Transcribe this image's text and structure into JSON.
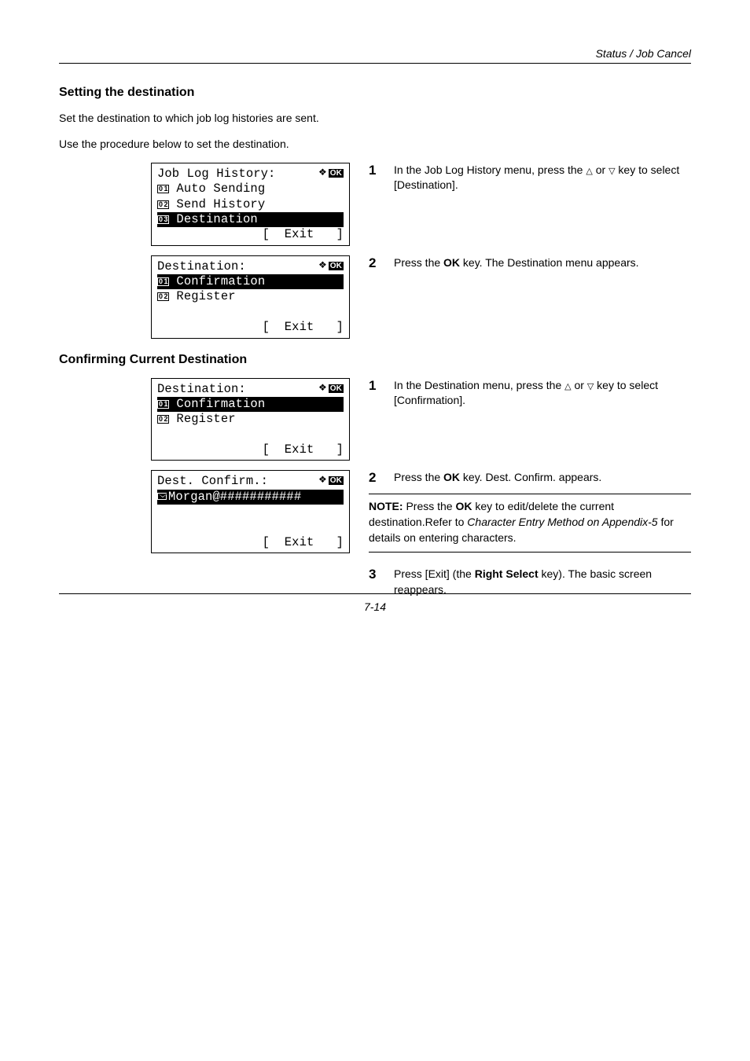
{
  "header": {
    "running_head": "Status / Job Cancel"
  },
  "section1": {
    "heading": "Setting the destination",
    "p1": "Set the destination to which job log histories are sent.",
    "p2": "Use the procedure below to set the destination.",
    "lcd1": {
      "title": "Job Log History:",
      "item1": "Auto Sending",
      "item2": "Send History",
      "item3": "Destination",
      "exit": "[  Exit   ]"
    },
    "step1": {
      "num": "1",
      "pre": "In the Job Log History menu, press the ",
      "post": " key to select [Destination]."
    },
    "lcd2": {
      "title": "Destination:",
      "item1": "Confirmation",
      "item2": "Register",
      "exit": "[  Exit   ]"
    },
    "step2": {
      "num": "2",
      "text_a": "Press the ",
      "ok": "OK",
      "text_b": " key. The Destination menu appears."
    }
  },
  "section2": {
    "heading": "Confirming Current Destination",
    "lcd1": {
      "title": "Destination:",
      "item1": "Confirmation",
      "item2": "Register",
      "exit": "[  Exit   ]"
    },
    "step1": {
      "num": "1",
      "pre": "In the Destination menu, press the ",
      "post": " key to select [Confirmation]."
    },
    "lcd2": {
      "title": "Dest. Confirm.:",
      "item1": "Morgan@###########",
      "exit": "[  Exit   ]"
    },
    "step2": {
      "num": "2",
      "text_a": "Press the ",
      "ok": "OK",
      "text_b": " key. Dest. Confirm. appears."
    },
    "note": {
      "label": "NOTE:",
      "a": " Press the ",
      "ok": "OK",
      "b": " key to edit/delete the current destination.Refer to ",
      "ref": "Character Entry Method on Appendix-5",
      "c": " for details on entering characters."
    },
    "step3": {
      "num": "3",
      "a": "Press [Exit] (the ",
      "rs": "Right Select",
      "b": " key). The basic screen reappears."
    }
  },
  "footer": {
    "page": "7-14"
  },
  "glyph": {
    "or": " or ",
    "up": "△",
    "down": "▽"
  }
}
